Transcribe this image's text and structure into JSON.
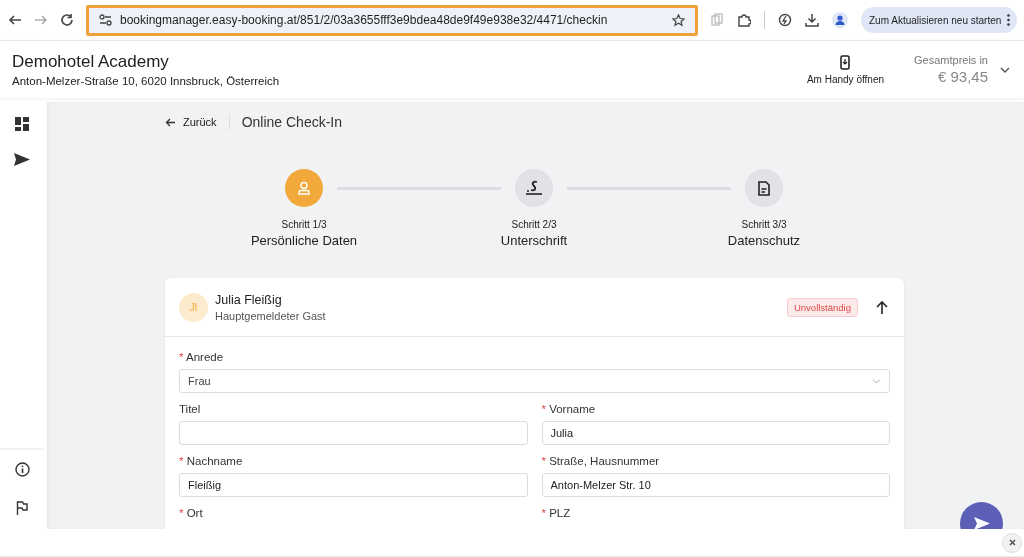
{
  "browser": {
    "url": "bookingmanager.easy-booking.at/851/2/03a3655fff3e9bdea48de9f49e938e32/4471/checkin",
    "highlighted": true,
    "update_button": "Zum Aktualisieren neu starten"
  },
  "hotel": {
    "name": "Demohotel Academy",
    "address": "Anton-Melzer-Straße 10, 6020 Innsbruck, Österreich"
  },
  "mobile_button": "Am Handy öffnen",
  "total": {
    "label": "Gesamtpreis in",
    "amount": "€ 93,45"
  },
  "back": "Zurück",
  "page_title": "Online Check-In",
  "steps": [
    {
      "step": "Schritt 1/3",
      "label": "Persönliche Daten",
      "selected": true
    },
    {
      "step": "Schritt 2/3",
      "label": "Unterschrift",
      "selected": false
    },
    {
      "step": "Schritt 3/3",
      "label": "Datenschutz",
      "selected": false
    }
  ],
  "guest": {
    "initials": "JI",
    "name": "Julia Fleißig",
    "role": "Hauptgemeldeter Gast",
    "status": "Unvollständig",
    "expanded": true
  },
  "fields": [
    {
      "required_mark": "*",
      "label": "Anrede",
      "kind": "select",
      "value": "Frau"
    },
    {
      "label": "Titel",
      "kind": "text"
    },
    {
      "required_mark": "*",
      "label": "Vorname",
      "kind": "text",
      "value": "Julia"
    },
    {
      "required_mark": "*",
      "label": "Nachname",
      "kind": "text",
      "value": "Fleißig"
    },
    {
      "required_mark": "*",
      "label": "Straße, Hausnummer",
      "kind": "text",
      "value": "Anton-Melzer Str. 10"
    },
    {
      "required_mark": "*",
      "label": "Ort",
      "kind": "label"
    },
    {
      "required_mark": "*",
      "label": "PLZ",
      "kind": "label"
    }
  ]
}
